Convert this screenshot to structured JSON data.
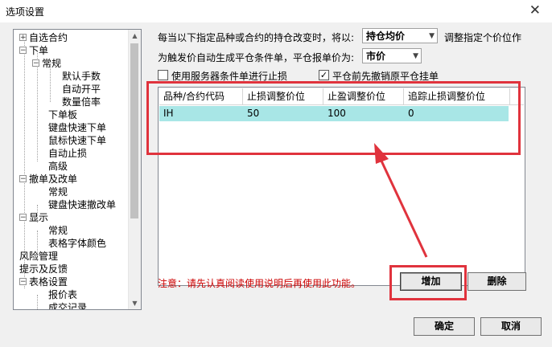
{
  "window": {
    "title": "选项设置",
    "close_glyph": "✕"
  },
  "tree": {
    "nodes": [
      {
        "label": "自选合约",
        "expander": "+"
      },
      {
        "label": "下单",
        "expander": "−"
      },
      {
        "label": "常规",
        "expander": "−"
      },
      {
        "label": "默认手数"
      },
      {
        "label": "自动开平"
      },
      {
        "label": "数量倍率"
      },
      {
        "label": "下单板"
      },
      {
        "label": "键盘快速下单"
      },
      {
        "label": "鼠标快速下单"
      },
      {
        "label": "自动止损"
      },
      {
        "label": "高级"
      },
      {
        "label": "撤单及改单",
        "expander": "−"
      },
      {
        "label": "常规"
      },
      {
        "label": "键盘快速撤改单"
      },
      {
        "label": "显示",
        "expander": "−"
      },
      {
        "label": "常规"
      },
      {
        "label": "表格字体颜色"
      },
      {
        "label": "风险管理"
      },
      {
        "label": "提示及反馈"
      },
      {
        "label": "表格设置",
        "expander": "−"
      },
      {
        "label": "报价表"
      },
      {
        "label": "成交记录"
      }
    ]
  },
  "settings": {
    "price_prefix": "每当以下指定品种或合约的持仓改变时，将以:",
    "price_value": "持仓均价",
    "price_suffix": "调整指定个价位作",
    "order_price_label": "为触发价自动生成平仓条件单，平仓报单价为:",
    "order_price_value": "市价",
    "server_check": {
      "label": "使用服务器条件单进行止损",
      "checked": false
    },
    "cancel_check": {
      "label": "平仓前先撤销原平仓挂单",
      "checked": true,
      "mark": "✓"
    }
  },
  "grid": {
    "columns": [
      "品种/合约代码",
      "止损调整价位",
      "止盈调整价位",
      "追踪止损调整价位"
    ],
    "rows": [
      {
        "code": "IH",
        "stop_loss": "50",
        "take_profit": "100",
        "trailing": "0"
      }
    ]
  },
  "warning": "注意：请先认真阅读使用说明后再使用此功能。",
  "buttons": {
    "add": "增加",
    "delete": "删除",
    "ok": "确定",
    "cancel": "取消"
  },
  "colors": {
    "row_highlight": "#a8e6e6",
    "annotation_red": "#e0333d",
    "warning": "#cc0000"
  }
}
